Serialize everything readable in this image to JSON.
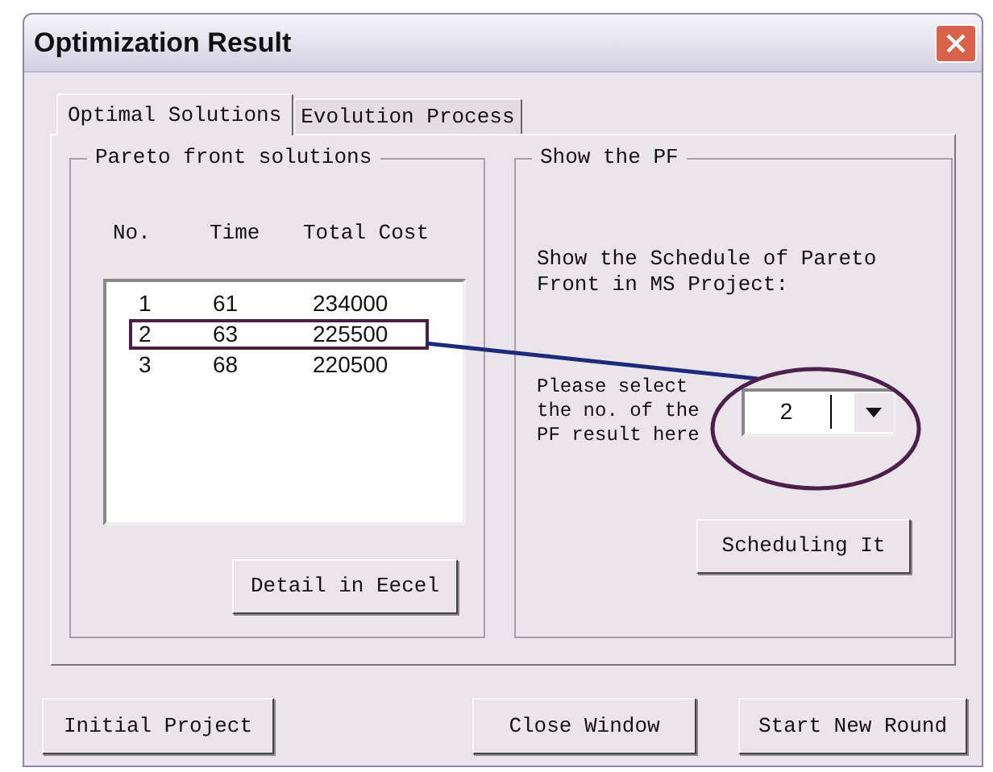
{
  "window": {
    "title": "Optimization Result"
  },
  "tabs": [
    {
      "label": "Optimal Solutions",
      "selected": true
    },
    {
      "label": "Evolution Process",
      "selected": false
    }
  ],
  "pareto_group": {
    "title": "Pareto front solutions",
    "columns": [
      "No.",
      "Time",
      "Total Cost"
    ],
    "rows": [
      {
        "cells": [
          "1",
          "61",
          "234000"
        ],
        "highlighted": false
      },
      {
        "cells": [
          "2",
          "63",
          "225500"
        ],
        "highlighted": true
      },
      {
        "cells": [
          "3",
          "68",
          "220500"
        ],
        "highlighted": false
      }
    ],
    "button": "Detail in Eecel"
  },
  "pf_group": {
    "title": "Show the PF",
    "description": [
      "Show the Schedule of Pareto",
      "Front in MS Project:"
    ],
    "prompt": [
      "Please select",
      "the no. of the",
      "PF result here"
    ],
    "select": {
      "value": "2"
    },
    "button": "Scheduling It"
  },
  "buttons": [
    "Initial Project",
    "Close Window",
    "Start New Round"
  ]
}
